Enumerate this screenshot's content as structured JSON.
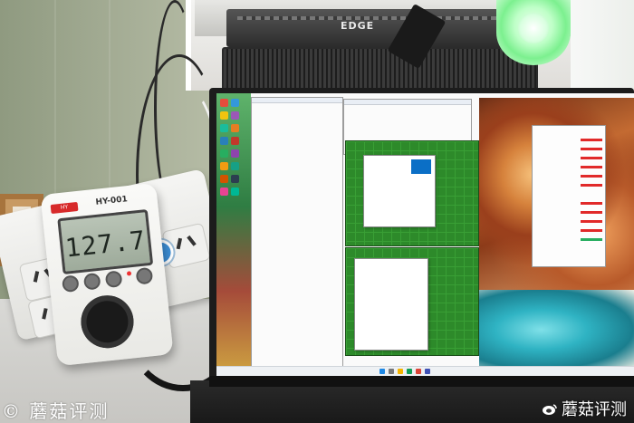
{
  "photo": {
    "gpu_brand_label": "EDGE",
    "meter": {
      "brand": "HY",
      "model": "HY-001",
      "reading": "127.7",
      "buttons": [
        "",
        "",
        "",
        ""
      ]
    },
    "watermark_left": "©  蘑菇评测",
    "watermark_right": "蘑菇评测"
  }
}
